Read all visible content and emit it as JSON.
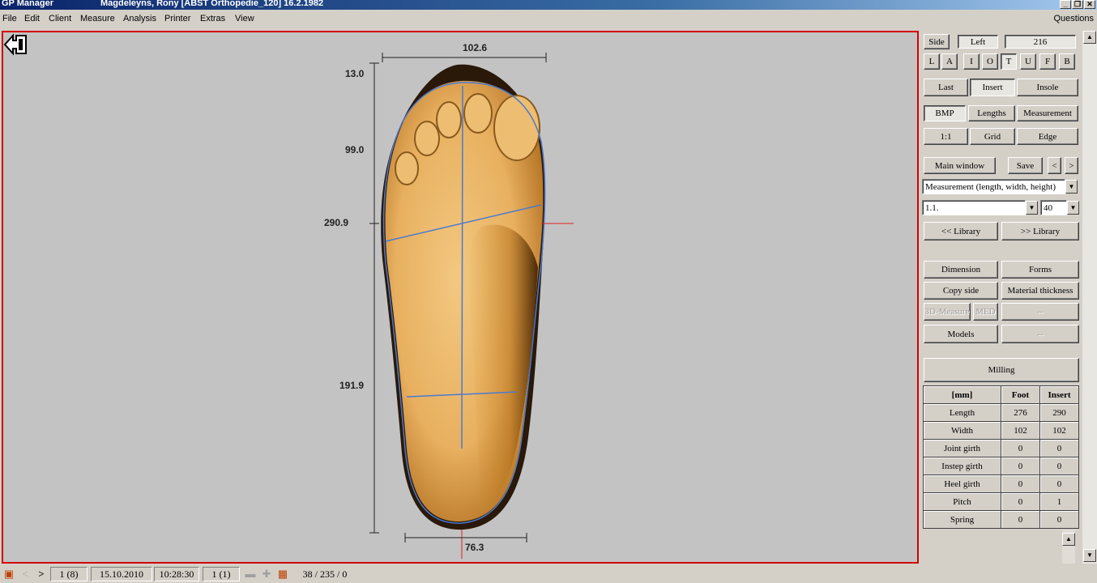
{
  "titlebar": {
    "app": "GP Manager",
    "info": "Magdeleyns, Rony  [ABST Orthopedie_120]  16.2.1982"
  },
  "menu": [
    "File",
    "Edit",
    "Client",
    "Measure",
    "Analysis",
    "Printer",
    "Extras",
    "View"
  ],
  "questions_label": "Questions",
  "canvas": {
    "width_top_label": "102.6",
    "width_bottom_label": "76.3",
    "marker_1": "13.0",
    "marker_2": "99.0",
    "marker_3": "290.9",
    "marker_4": "191.9"
  },
  "panel": {
    "side_label": "Side",
    "side_value": "Left",
    "number_value": "216",
    "view_buttons": [
      "L",
      "A",
      "I",
      "O",
      "T",
      "U",
      "F",
      "B"
    ],
    "view_selected": "T",
    "mode_tabs": [
      "Last",
      "Insert",
      "Insole"
    ],
    "mode_selected": "Insert",
    "display_tabs": [
      "BMP",
      "Lengths",
      "Measurement"
    ],
    "display_selected": "BMP",
    "zoom_buttons": [
      "1:1",
      "Grid",
      "Edge"
    ],
    "main_window": "Main window",
    "save": "Save",
    "prev": "<",
    "next": ">",
    "measurement_select": "Measurement (length, width, height)",
    "item_select": "1.1.",
    "size_select": "40",
    "library_prev": "<< Library",
    "library_next": ">> Library",
    "dimension": "Dimension",
    "forms": "Forms",
    "copy_side": "Copy side",
    "material_thickness": "Material thickness",
    "measure_3d": "3D-Measure",
    "med": "MED",
    "dash1": "--",
    "models": "Models",
    "dash2": "--",
    "milling": "Milling"
  },
  "table": {
    "headers": [
      "[mm]",
      "Foot",
      "Insert"
    ],
    "rows": [
      [
        "Length",
        "276",
        "290"
      ],
      [
        "Width",
        "102",
        "102"
      ],
      [
        "Joint girth",
        "0",
        "0"
      ],
      [
        "Instep girth",
        "0",
        "0"
      ],
      [
        "Heel girth",
        "0",
        "0"
      ],
      [
        "Pitch",
        "0",
        "1"
      ],
      [
        "Spring",
        "0",
        "0"
      ]
    ]
  },
  "status": {
    "record": "1 (8)",
    "date": "15.10.2010",
    "time": "10:28:30",
    "page": "1 (1)",
    "coords": "38 / 235 / 0"
  }
}
